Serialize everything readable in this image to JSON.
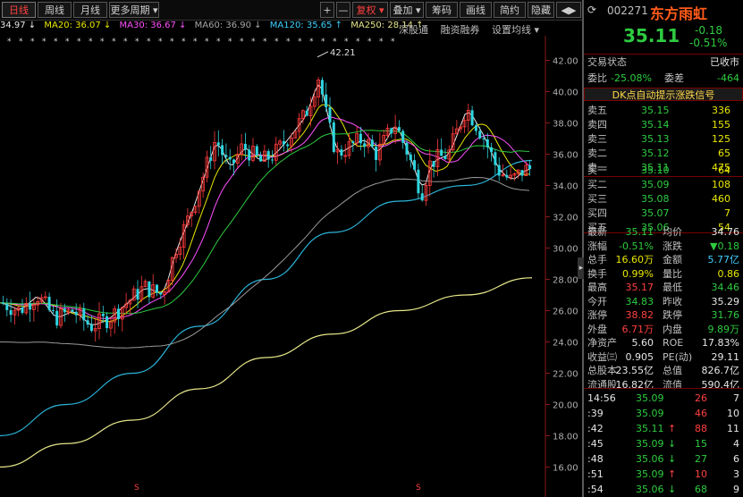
{
  "tabs": [
    {
      "label": "日线",
      "active": true
    },
    {
      "label": "周线"
    },
    {
      "label": "月线"
    },
    {
      "label": "更多周期 ▾"
    }
  ],
  "toolbar": {
    "plus": "+",
    "minus": "—",
    "fuquan": "复权 ▾",
    "diejia": "叠加 ▾",
    "chouma": "筹码",
    "huaxian": "画线",
    "jianyue": "简约",
    "yincang": "隐藏",
    "arrows": "◀▶"
  },
  "ma": {
    "ma5": "34.97 ↓",
    "ma20": "MA20: 36.07 ↓",
    "ma30": "MA30: 36.67 ↓",
    "ma60": "MA60: 36.90 ↓",
    "ma120": "MA120: 35.65 ↑",
    "ma250": "MA250: 28.14 ↑"
  },
  "chart_links": {
    "shenguantong": "深股通",
    "rongzirongquan": "融资融券",
    "shezhijunxian": "设置均线 ▾"
  },
  "chart_data": {
    "type": "line",
    "price_axis": [
      "42.00",
      "40.00",
      "38.00",
      "36.00",
      "34.00",
      "32.00",
      "30.00",
      "28.00",
      "26.00",
      "24.00",
      "22.00",
      "20.00",
      "18.00",
      "16.00"
    ],
    "high_label": "42.21",
    "ylim": [
      15,
      43
    ],
    "ma_series": [
      {
        "name": "MA120",
        "color": "#2ab4d8",
        "values": [
          18,
          20,
          22,
          25,
          28,
          31,
          33,
          34,
          35.6
        ]
      },
      {
        "name": "MA250",
        "color": "#e6e68a",
        "values": [
          16,
          17.5,
          19,
          21,
          23,
          24.5,
          26,
          27,
          28.1
        ]
      }
    ],
    "s_markers": [
      "S",
      "S"
    ]
  },
  "quote": {
    "code": "002271",
    "name": "东方雨虹",
    "price": "35.11",
    "change": "-0.18",
    "pct": "-0.51%",
    "status_label": "交易状态",
    "status": "已收市",
    "webi_label": "委比",
    "webi": "-25.08%",
    "wecha_label": "委差",
    "wecha": "-464",
    "banner": "DK点自动提示涨跌信号",
    "asks": [
      {
        "l": "卖五",
        "p": "35.15",
        "v": "336"
      },
      {
        "l": "卖四",
        "p": "35.14",
        "v": "155"
      },
      {
        "l": "卖三",
        "p": "35.13",
        "v": "125"
      },
      {
        "l": "卖二",
        "p": "35.12",
        "v": "65"
      },
      {
        "l": "卖一",
        "p": "35.11",
        "v": "475"
      }
    ],
    "bids": [
      {
        "l": "买一",
        "p": "35.10",
        "v": "64"
      },
      {
        "l": "买二",
        "p": "35.09",
        "v": "108"
      },
      {
        "l": "买三",
        "p": "35.08",
        "v": "460"
      },
      {
        "l": "买四",
        "p": "35.07",
        "v": "7"
      },
      {
        "l": "买五",
        "p": "35.06",
        "v": "54"
      }
    ],
    "stats": [
      {
        "a": "最新",
        "av": "35.11",
        "ac": "dn",
        "b": "均价",
        "bv": "34.76",
        "bc": "wh"
      },
      {
        "a": "涨幅",
        "av": "-0.51%",
        "ac": "dn",
        "b": "涨跌",
        "bv": "▼0.18",
        "bc": "dn"
      },
      {
        "a": "总手",
        "av": "16.60万",
        "ac": "yl",
        "b": "金额",
        "bv": "5.77亿",
        "bc": "cy"
      },
      {
        "a": "换手",
        "av": "0.99%",
        "ac": "yl",
        "b": "量比",
        "bv": "0.86",
        "bc": "yl"
      },
      {
        "a": "最高",
        "av": "35.17",
        "ac": "up",
        "b": "最低",
        "bv": "34.46",
        "bc": "dn"
      },
      {
        "a": "今开",
        "av": "34.83",
        "ac": "dn",
        "b": "昨收",
        "bv": "35.29",
        "bc": "wh"
      },
      {
        "a": "涨停",
        "av": "38.82",
        "ac": "up",
        "b": "跌停",
        "bv": "31.76",
        "bc": "dn"
      },
      {
        "a": "外盘",
        "av": "6.71万",
        "ac": "up",
        "b": "内盘",
        "bv": "9.89万",
        "bc": "dn"
      },
      {
        "a": "净资产",
        "av": "5.60",
        "ac": "wh",
        "b": "ROE",
        "bv": "17.83%",
        "bc": "wh"
      },
      {
        "a": "收益㈢",
        "av": "0.905",
        "ac": "wh",
        "b": "PE(动)",
        "bv": "29.11",
        "bc": "wh"
      },
      {
        "a": "总股本",
        "av": "23.55亿",
        "ac": "wh",
        "b": "总值",
        "bv": "826.7亿",
        "bc": "wh"
      },
      {
        "a": "流通股",
        "av": "16.82亿",
        "ac": "wh",
        "b": "流值",
        "bv": "590.4亿",
        "bc": "wh"
      }
    ],
    "ticks": [
      {
        "t": "14:56",
        "p": "35.09",
        "arrow": "",
        "v": "26",
        "vc": "up",
        "n": "7"
      },
      {
        "t": ":39",
        "p": "35.09",
        "arrow": "",
        "v": "46",
        "vc": "up",
        "n": "10"
      },
      {
        "t": ":42",
        "p": "35.11",
        "arrow": "↑",
        "v": "88",
        "vc": "up",
        "n": "11"
      },
      {
        "t": ":45",
        "p": "35.09",
        "arrow": "↓",
        "v": "15",
        "vc": "dn",
        "n": "4"
      },
      {
        "t": ":48",
        "p": "35.06",
        "arrow": "↓",
        "v": "27",
        "vc": "dn",
        "n": "6"
      },
      {
        "t": ":51",
        "p": "35.09",
        "arrow": "↑",
        "v": "10",
        "vc": "up",
        "n": "3"
      },
      {
        "t": ":54",
        "p": "35.06",
        "arrow": "↓",
        "v": "68",
        "vc": "dn",
        "n": "9"
      }
    ]
  }
}
